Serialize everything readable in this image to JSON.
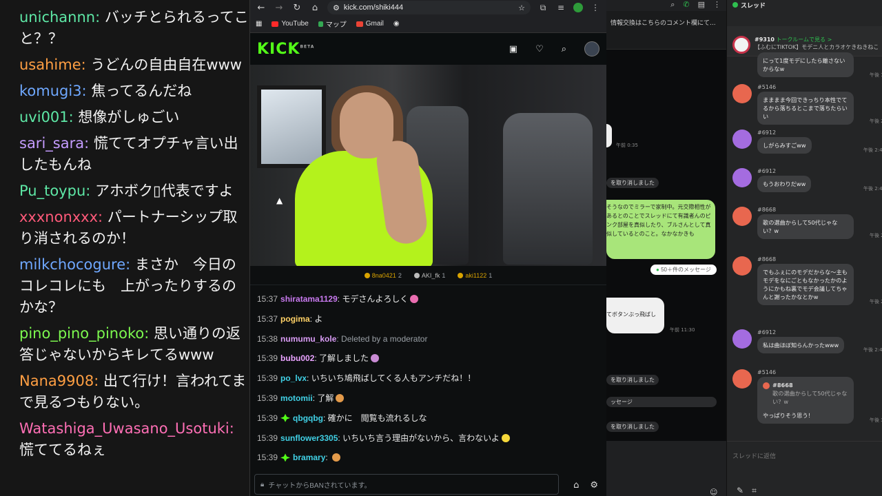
{
  "left_chat": {
    "messages": [
      {
        "user": "unichannn:",
        "text": " バッチとられるってこと？？",
        "color": "#5ee8a6"
      },
      {
        "user": "usahime:",
        "text": " うどんの自由自在www",
        "color": "#ff9f43"
      },
      {
        "user": "komugi3:",
        "text": " 焦ってるんだね",
        "color": "#6fa8ff"
      },
      {
        "user": "uvi001:",
        "text": " 想像がしゅごい",
        "color": "#5ee8a6"
      },
      {
        "user": "sari_sara:",
        "text": " 慌ててオプチャ言い出したもんね",
        "color": "#c59cff"
      },
      {
        "user": "Pu_toypu:",
        "text": " アホボク▯代表ですよ",
        "color": "#5ee8a6"
      },
      {
        "user": "xxxnonxxx:",
        "text": " パートナーシップ取り消されるのか！",
        "color": "#ff5a7a"
      },
      {
        "user": "milkchocogure:",
        "text": " まさか　今日のコレコレにも　上がったりするのかな？",
        "color": "#6fa8ff"
      },
      {
        "user": "pino_pino_pinoko:",
        "text": " 思い通りの返答じゃないからキレてるwww",
        "color": "#7cf84f"
      },
      {
        "user": "Nana9908:",
        "text": " 出て行け！言われてまで見るつもりない。",
        "color": "#ff9f43"
      },
      {
        "user": "Watashiga_Uwasano_Usotuki:",
        "text": " 慌ててるねぇ",
        "color": "#ff6fb5"
      }
    ]
  },
  "browser": {
    "url": "kick.com/shiki444",
    "bookmarks": [
      {
        "label": "YouTube",
        "color": "#ff2a2a"
      },
      {
        "label": "マップ",
        "color": "#34a853"
      },
      {
        "label": "Gmail",
        "color": "#ea4335"
      }
    ]
  },
  "kick": {
    "logo": "KICK",
    "logo_sup": "BETA",
    "top_viewers": [
      {
        "name": "8na0421",
        "count": "2",
        "color": "#d9a300"
      },
      {
        "name": "AKI_fk",
        "count": "1",
        "color": "#bbbbbb"
      },
      {
        "name": "aki1122",
        "count": "1",
        "color": "#d9a300"
      }
    ],
    "chat": [
      {
        "time": "15:37",
        "user": "shiratama1129",
        "text": ": モデさんよろしく",
        "color": "#c97af0",
        "emo": "#e96db0"
      },
      {
        "time": "15:37",
        "user": "pogima",
        "text": ": よ",
        "color": "#ffd166"
      },
      {
        "time": "15:38",
        "user": "numumu_kole",
        "text": ": Deleted by a moderator",
        "color": "#d99cf5",
        "deleted": true
      },
      {
        "time": "15:39",
        "user": "bubu002",
        "text": ": 了解しました",
        "color": "#e9a2ff",
        "emo": "#c98bd4"
      },
      {
        "time": "15:39",
        "user": "po_lvx",
        "text": ": いちいち鳩飛ばしてくる人もアンチだね！！",
        "color": "#41d1e6"
      },
      {
        "time": "15:39",
        "user": "motomii",
        "text": ": 了解",
        "color": "#41d1e6",
        "emo": "#e39a4a"
      },
      {
        "time": "15:39",
        "user": "qbgqbg",
        "text": ": 確かに　閲覧も流れるしな",
        "color": "#41d1e6",
        "badge": "#53fc18"
      },
      {
        "time": "15:39",
        "user": "sunflower3305",
        "text": ": いちいち言う理由がないから、言わないよ",
        "color": "#41d1e6",
        "emo": "#f5d83a"
      },
      {
        "time": "15:39",
        "user": "bramary",
        "text": ": ",
        "color": "#41d1e6",
        "badge": "#53fc18",
        "emo": "#e39a4a"
      }
    ],
    "input_placeholder": "チャットからBANされています。"
  },
  "line": {
    "subtitle": "情報交換はこちらのコメント欄にて...",
    "time_1": "午前 0:35",
    "sys_1": "を取り消しました",
    "green_text": "そうなのでミラーで家制中。元交際相性があるとのことでスレッドにて有識者んのピンク部屋を真似したり、ブルさんとして真似しているとのこと。なかなかきも",
    "more_messages": "50＋件のメッセージ",
    "white_text": "てボタンぶっ飛ばし",
    "time_2": "午前 11:30",
    "sys_2": "を取り消しました",
    "sys_3": "ッセージ",
    "sys_4": "を取り消しました"
  },
  "thread": {
    "title": "スレッド",
    "pinned_id": "#9310",
    "pinned_link": "トークルームで見る >",
    "pinned_text": "【ふむにTIKTOK】モデニ人とカラオケきねきねこに意",
    "items": [
      {
        "id": "",
        "text": "にって1度モデにしたら離さないからなw",
        "time": "午後 1:",
        "av": "r"
      },
      {
        "id": "#5146",
        "text": "まままま今回できっちり本性でてるから落ちるとこまで落ちたらいい",
        "time": "午後 2:",
        "av": "r"
      },
      {
        "id": "#6912",
        "text": "しがらみすごww",
        "time": "午後 2:42",
        "av": "p"
      },
      {
        "id": "#6912",
        "text": "もうおわりだww",
        "time": "午後 2:43",
        "av": "p"
      },
      {
        "id": "#8668",
        "text": "歌の選曲からして50代じゃない？w",
        "time": "午後 2:",
        "av": "r"
      },
      {
        "id": "#8668",
        "text": "でもふぇにのモデだからな〜主もモデをなにごともなかったかのようにかもね裏でモデ会議してちゃんと謝ったかなとかw",
        "time": "午後 2:",
        "av": "r"
      },
      {
        "id": "#6912",
        "text": "私は曲ほぼ知らんかったwww",
        "time": "午後 2:46",
        "av": "p"
      },
      {
        "id": "#5146",
        "reply_id": "#8668",
        "reply_text": "歌の選曲からして50代じゃない？w",
        "text": "やっぱりそう思う！",
        "time": "午後 3:",
        "av": "r"
      }
    ],
    "input_placeholder": "スレッドに返信"
  }
}
